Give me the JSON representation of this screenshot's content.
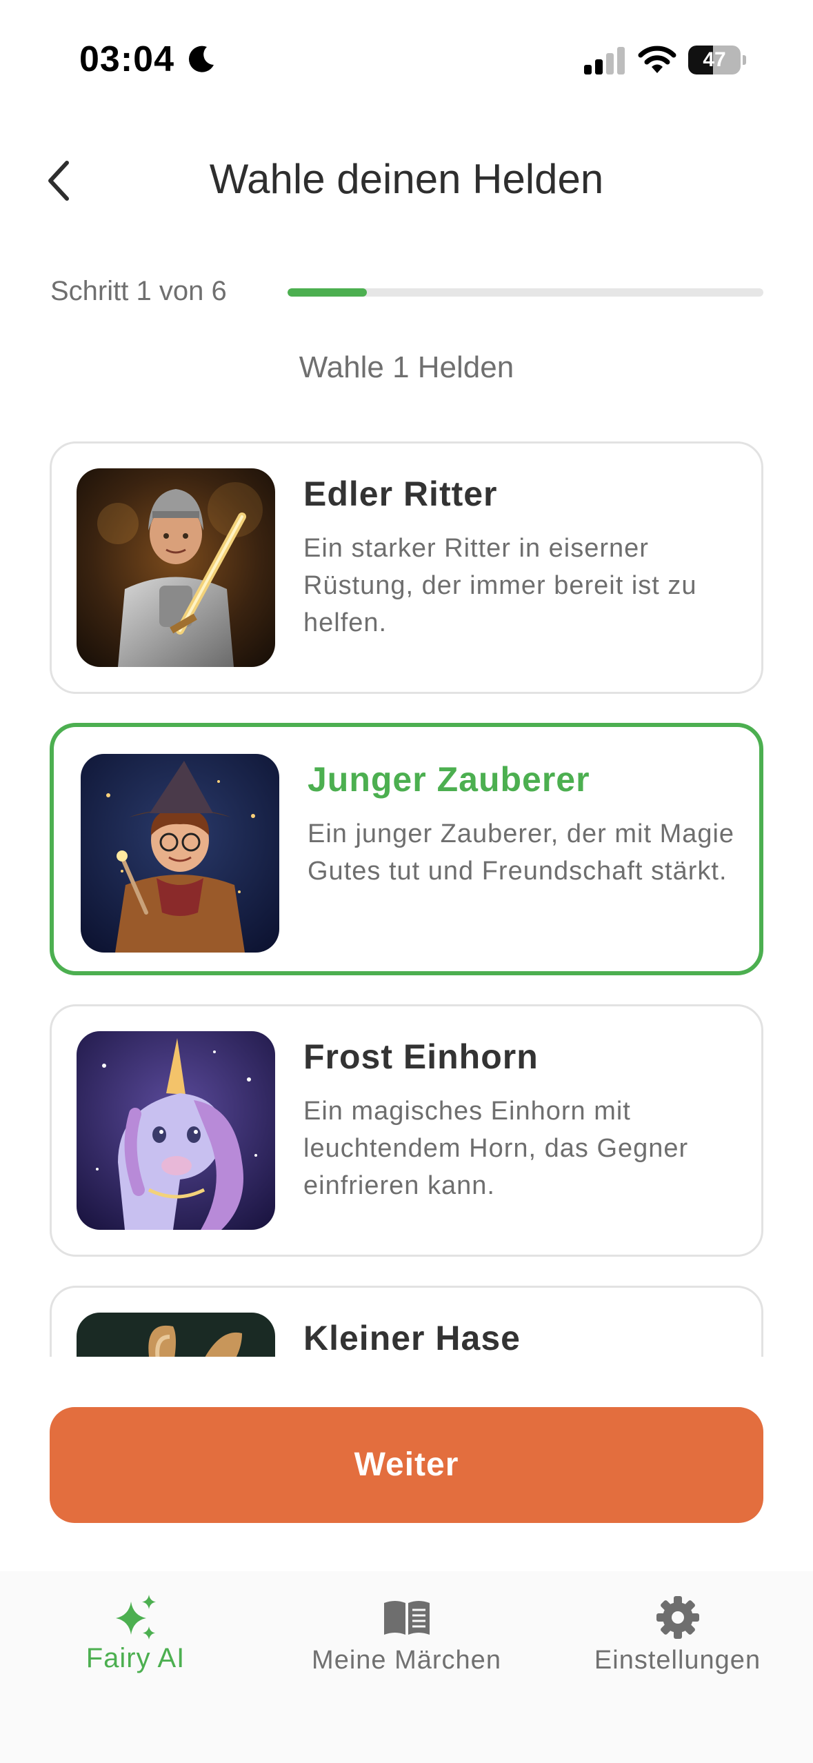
{
  "status_bar": {
    "time": "03:04",
    "battery_percent": "47",
    "battery_level": 0.47
  },
  "header": {
    "title": "Wahle deinen Helden",
    "back_icon": "chevron-left-icon"
  },
  "progress": {
    "step_text": "Schritt 1 von 6",
    "current_step": 1,
    "total_steps": 6
  },
  "subtitle": "Wahle 1 Helden",
  "heroes": [
    {
      "name": "Edler Ritter",
      "description": "Ein starker Ritter in eiserner Rüstung, der immer bereit ist zu helfen.",
      "selected": false
    },
    {
      "name": "Junger Zauberer",
      "description": "Ein junger Zauberer, der mit Magie Gutes tut und Freundschaft stärkt.",
      "selected": true
    },
    {
      "name": "Frost Einhorn",
      "description": "Ein magisches Einhorn mit leuchtendem Horn, das Gegner einfrieren kann.",
      "selected": false
    },
    {
      "name": "Kleiner Hase",
      "description": "",
      "selected": false
    }
  ],
  "continue_label": "Weiter",
  "tabs": [
    {
      "label": "Fairy AI",
      "icon": "sparkles-icon",
      "active": true
    },
    {
      "label": "Meine Märchen",
      "icon": "book-icon",
      "active": false
    },
    {
      "label": "Einstellungen",
      "icon": "gear-icon",
      "active": false
    }
  ],
  "colors": {
    "accent_green": "#4caf50",
    "button_orange": "#e36e3e",
    "text_dark": "#333333",
    "text_muted": "#6e6e6e"
  }
}
